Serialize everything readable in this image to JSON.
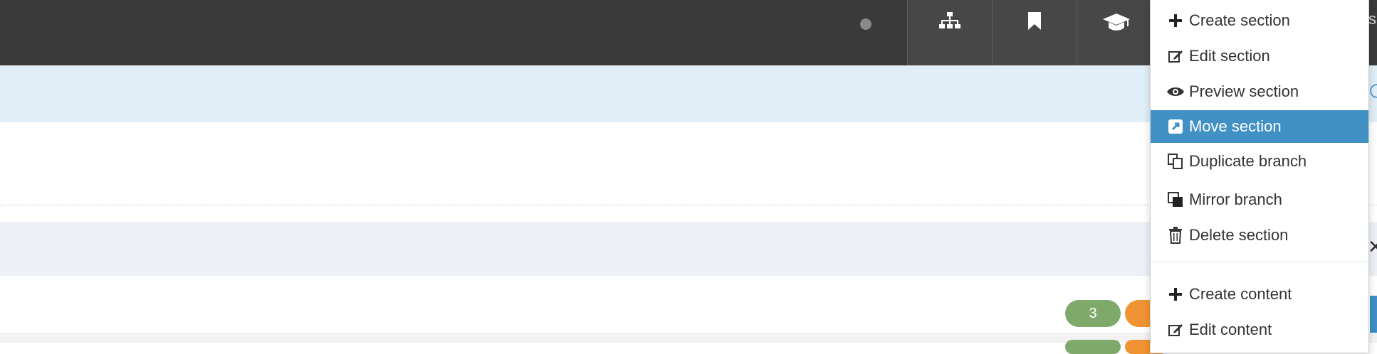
{
  "topbar": {
    "buttons": [
      {
        "icon": "sitemap-icon"
      },
      {
        "icon": "bookmark-icon"
      },
      {
        "icon": "graduation-cap-icon"
      }
    ],
    "clipped_text": "s"
  },
  "badges": {
    "count": "3"
  },
  "menu": {
    "items": [
      {
        "label": "Create section",
        "icon": "plus-icon"
      },
      {
        "label": "Edit section",
        "icon": "edit-icon"
      },
      {
        "label": "Preview section",
        "icon": "eye-icon"
      },
      {
        "label": "Move section",
        "icon": "move-icon",
        "active": true
      },
      {
        "label": "Duplicate branch",
        "icon": "copy-icon"
      },
      {
        "label": "Mirror branch",
        "icon": "mirror-icon"
      },
      {
        "label": "Delete section",
        "icon": "trash-icon"
      },
      {
        "label": "Create content",
        "icon": "plus-icon"
      },
      {
        "label": "Edit content",
        "icon": "edit-icon"
      }
    ]
  },
  "colors": {
    "topbar": "#3a3a3a",
    "active": "#4291c4",
    "badge_green": "#7fa96b",
    "badge_orange": "#f09433"
  }
}
